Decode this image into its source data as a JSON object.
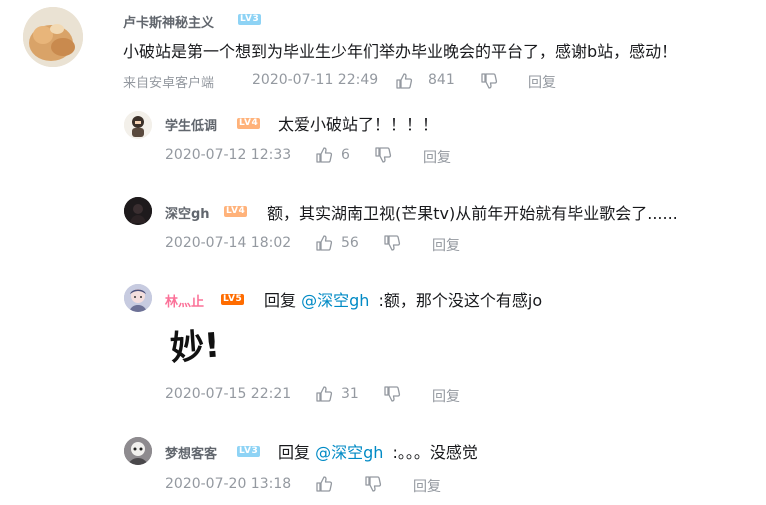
{
  "comment": {
    "username": "卢卡斯神秘主义",
    "level": "LV3",
    "text": "小破站是第一个想到为毕业生少年们举办毕业晚会的平台了，感谢b站，感动！",
    "source": "来自安卓客户端",
    "time": "2020-07-11 22:49",
    "likes": "841",
    "reply_label": "回复"
  },
  "replies": [
    {
      "username": "学生低调",
      "level": "LV4",
      "text": "太爱小破站了！！！！",
      "time": "2020-07-12 12:33",
      "likes": "6",
      "reply_label": "回复"
    },
    {
      "username": "深空gh",
      "level": "LV4",
      "text": "额，其实湖南卫视(芒果tv)从前年开始就有毕业歌会了......",
      "time": "2020-07-14 18:02",
      "likes": "56",
      "reply_label": "回复"
    },
    {
      "username": "林灬止",
      "level": "LV5",
      "prefix": "回复",
      "mention": "@深空gh",
      "text": ":额，那个没这个有感jo",
      "sticker": "妙!",
      "time": "2020-07-15 22:21",
      "likes": "31",
      "reply_label": "回复"
    },
    {
      "username": "梦想客客",
      "level": "LV3",
      "prefix": "回复",
      "mention": "@深空gh",
      "text": ":。。。没感觉",
      "time": "2020-07-20 13:18",
      "likes": "",
      "reply_label": "回复"
    }
  ],
  "colors": {
    "lv3": "#8ed3f5",
    "lv4": "#ffb27a",
    "lv5": "#ff6c00",
    "mention": "#008ac5",
    "meta": "#9499a0"
  },
  "icons": [
    "thumb-up-icon",
    "thumb-down-icon"
  ]
}
